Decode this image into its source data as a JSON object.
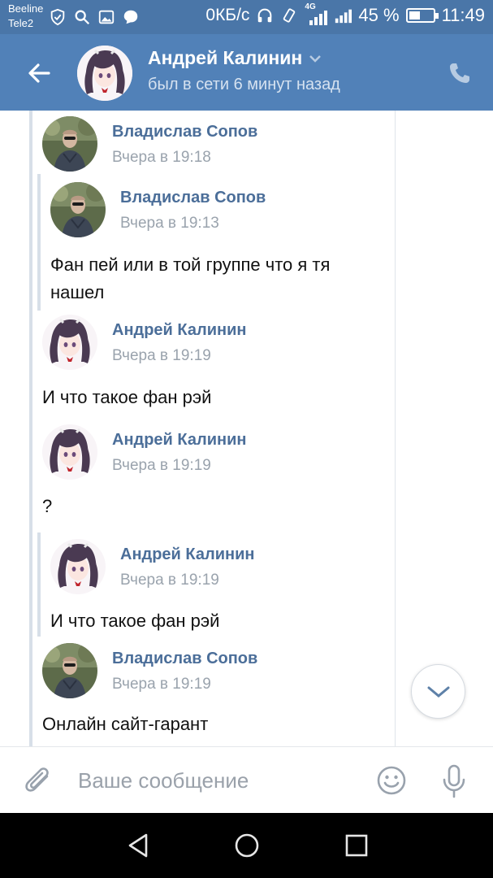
{
  "status_bar": {
    "carrier_1": "Beeline",
    "carrier_2": "Tele2",
    "net_speed": "0КБ/с",
    "network_type": "4G",
    "battery_percent": "45 %",
    "battery_level": 0.45,
    "time": "11:49"
  },
  "header": {
    "contact_name": "Андрей Калинин",
    "contact_status": "был в сети 6 минут назад"
  },
  "messages": [
    {
      "sender": "Владислав Сопов",
      "time": "Вчера в 19:18",
      "avatar": "man-photo"
    },
    {
      "sender": "Владислав Сопов",
      "time": "Вчера в 19:13",
      "text": "Фан пей или в той группе что я тя нашел",
      "avatar": "man-photo"
    },
    {
      "sender": "Андрей Калинин",
      "time": "Вчера в 19:19",
      "text": "И что такое фан рэй",
      "avatar": "anime-girl"
    },
    {
      "sender": "Андрей Калинин",
      "time": "Вчера в 19:19",
      "text": "?",
      "avatar": "anime-girl"
    },
    {
      "sender": "Андрей Калинин",
      "time": "Вчера в 19:19",
      "text": "И что такое фан рэй",
      "avatar": "anime-girl"
    },
    {
      "sender": "Владислав Сопов",
      "time": "Вчера в 19:19",
      "text": "Онлайн сайт-гарант",
      "avatar": "man-photo"
    }
  ],
  "composer": {
    "placeholder": "Ваше сообщение"
  },
  "colors": {
    "header_bg": "#5181b8",
    "status_bg": "#4a76a8",
    "name_link": "#4b6e99",
    "time_gray": "#9aa3ad"
  }
}
